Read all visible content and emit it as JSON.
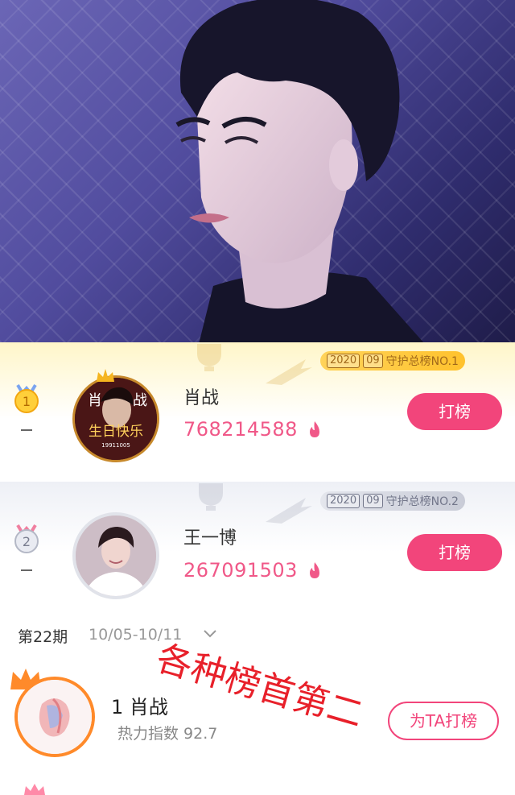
{
  "card1": {
    "rank": "1",
    "tag_year": "2020",
    "tag_month": "09",
    "tag_label": "守护总榜NO.1",
    "name": "肖战",
    "score": "768214588",
    "button": "打榜",
    "dash": "–",
    "avatar_text_top_left": "肖",
    "avatar_text_top_right": "战",
    "avatar_text_bottom": "生日快乐",
    "avatar_subtext": "19911005"
  },
  "card2": {
    "rank": "2",
    "tag_year": "2020",
    "tag_month": "09",
    "tag_label": "守护总榜NO.2",
    "name": "王一博",
    "score": "267091503",
    "button": "打榜",
    "dash": "–"
  },
  "list": {
    "period": "第22期",
    "dates": "10/05-10/11",
    "item1": {
      "rank_name": "1 肖战",
      "subtitle": "热力指数 92.7",
      "button": "为TA打榜"
    }
  },
  "overlay": {
    "line1": "各种榜首第二"
  },
  "colors": {
    "accent_pink": "#f2457b",
    "score_pink": "#f05888",
    "gold": "#ffc22d",
    "silver": "#c9ccd7",
    "crown_orange": "#ff8a2a",
    "overlay_red": "#e8202a"
  }
}
